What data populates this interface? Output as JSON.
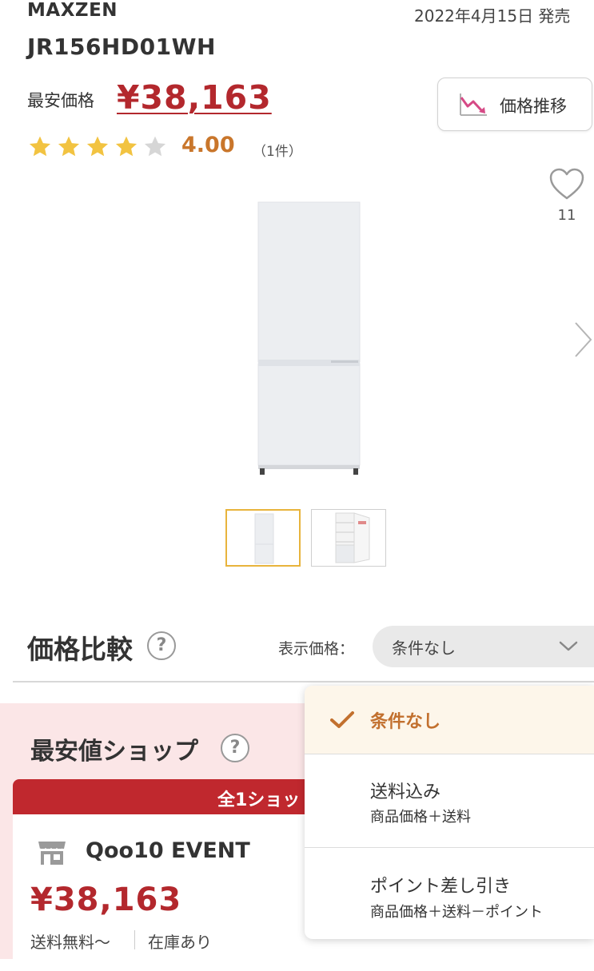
{
  "product": {
    "brand": "MAXZEN",
    "model": "JR156HD01WH",
    "release_date": "2022年4月15日 発売",
    "min_price_label": "最安価格",
    "min_price": "¥38,163",
    "rating_value": "4.00",
    "rating_count": "（1件）",
    "stars_filled": 4,
    "stars_total": 5,
    "favorite_count": "11"
  },
  "price_trend_button": {
    "label": "価格推移",
    "icon": "price-trend-chart-icon"
  },
  "gallery": {
    "thumbnail_count": 2,
    "selected_index": 0
  },
  "compare": {
    "title": "価格比較",
    "display_price_label": "表示価格：",
    "selected": "条件なし",
    "options": [
      {
        "title": "条件なし",
        "subtitle": "",
        "selected": true
      },
      {
        "title": "送料込み",
        "subtitle": "商品価格＋送料",
        "selected": false
      },
      {
        "title": "ポイント差し引き",
        "subtitle": "商品価格＋送料－ポイント",
        "selected": false
      }
    ]
  },
  "cheapest_shop": {
    "title": "最安値ショップ",
    "header": "全1ショッ",
    "shop_name": "Qoo10 EVENT",
    "price": "¥38,163",
    "shipping": "送料無料〜",
    "stock": "在庫あり"
  },
  "colors": {
    "price_red": "#b3282d",
    "rating_orange": "#c9762b",
    "star_gold": "#f2c341",
    "star_empty": "#d6d6d6",
    "section_pink": "#fbe6e7",
    "selected_option_bg": "#fdf6ea",
    "thumbnail_selected_border": "#e8b43c"
  }
}
